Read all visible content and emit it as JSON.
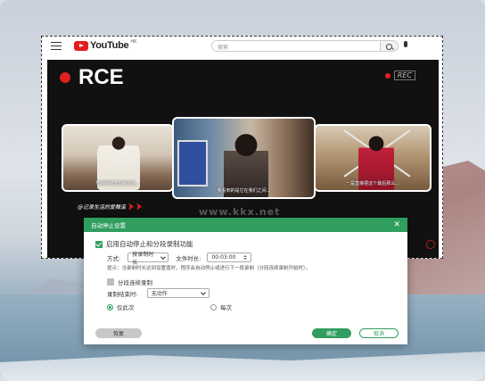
{
  "youtube": {
    "logo_text": "YouTube",
    "region": "HK",
    "search_placeholder": "搜索"
  },
  "video": {
    "title": "RCE",
    "rec_badge": "REC",
    "thumbnail_captions": [
      "然后我把发现就很快...",
      "我看到的是它在我们之间...",
      "一是直接把这个最后那么..."
    ],
    "tagline": "@记录生活的爱舞溪",
    "watermark": "www.kkx.net"
  },
  "dialog": {
    "title": "自动停止设置",
    "enable_label": "启用自动停止和分段录制功能",
    "enable_checked": true,
    "mode_label": "方式:",
    "mode_value": "按录制时长",
    "duration_label": "文件时长:",
    "duration_value": "00:03:00",
    "hint": "提示：当录制时长达到设置值时，程序会自动停止或进行下一段录制（分段连续录制开始时）。",
    "continuous_label": "分段连续录制",
    "continuous_checked": false,
    "after_label": "录制结束时:",
    "after_value": "无动作",
    "radio_once": "仅此次",
    "radio_each": "每次",
    "radio_selected": "once",
    "restore_button": "恢复",
    "ok_button": "确定",
    "cancel_button": "取消"
  },
  "colors": {
    "accent_green": "#2f9e5e",
    "rec_red": "#e02020"
  }
}
